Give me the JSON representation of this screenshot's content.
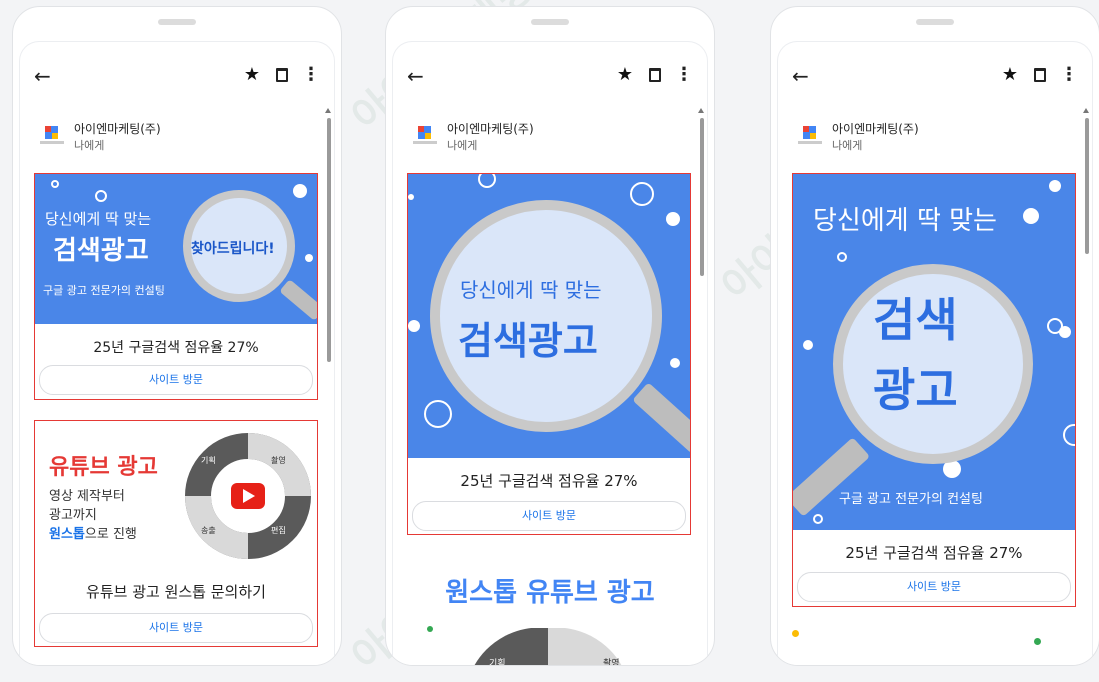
{
  "watermark": "아이엔마케팅",
  "phones": [
    {
      "sender": {
        "name": "아이엔마케팅(주)",
        "to": "나에게"
      },
      "ads": [
        {
          "line1": "당신에게 딱 맞는",
          "line2": "검색광고",
          "lens_text": "찾아드립니다!",
          "line3": "구글 광고 전문가의 컨설팅",
          "caption": "25년 구글검색 점유율 27%",
          "button": "사이트 방문"
        },
        {
          "title": "유튜브 광고",
          "body1": "영상 제작부터",
          "body2": "광고까지",
          "body3_blue": "원스톱",
          "body3_rest": "으로 진행",
          "ring_labels": [
            "기획",
            "촬영",
            "송출",
            "편집"
          ],
          "caption": "유튜브 광고 원스톱 문의하기",
          "button": "사이트 방문"
        }
      ]
    },
    {
      "sender": {
        "name": "아이엔마케팅(주)",
        "to": "나에게"
      },
      "ads": [
        {
          "line1": "당신에게 딱 맞는",
          "line2": "검색광고",
          "caption": "25년 구글검색 점유율 27%",
          "button": "사이트 방문"
        }
      ],
      "next_heading": "원스톱 유튜브 광고",
      "next_labels": [
        "기획",
        "촬영"
      ]
    },
    {
      "sender": {
        "name": "아이엔마케팅(주)",
        "to": "나에게"
      },
      "ads": [
        {
          "line1": "당신에게 딱 맞는",
          "line2a": "검색",
          "line2b": "광고",
          "line3": "구글 광고 전문가의 컨설팅",
          "caption": "25년 구글검색 점유율 27%",
          "button": "사이트 방문"
        }
      ]
    }
  ],
  "colors": {
    "banner_blue": "#4a86e8",
    "accent_red": "#e53935",
    "link_blue": "#1a73e8"
  }
}
